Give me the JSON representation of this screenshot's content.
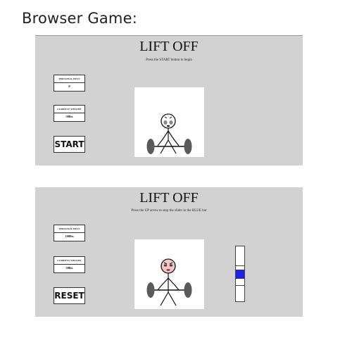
{
  "caption": "Browser Game:",
  "screens": [
    {
      "title": "LIFT OFF",
      "instruction": "Press the START button to begin",
      "personal_best": {
        "label": "PERSONAL BEST",
        "value": "0"
      },
      "current_weight": {
        "label": "CURRENT WEIGHT",
        "value": "50lbs"
      },
      "action_button": "START",
      "face_color": "#ffffff"
    },
    {
      "title": "LIFT OFF",
      "instruction": "Press the UP arrow to stop the slider in the BLUE bar",
      "personal_best": {
        "label": "PERSONAL BEST",
        "value": "100lbs"
      },
      "current_weight": {
        "label": "CURRENT WEIGHT",
        "value": "50lbs"
      },
      "action_button": "RESET",
      "face_color": "#f3c6c6"
    }
  ],
  "colors": {
    "panel_bg": "#d2d2d2",
    "target_bar": "#2020e0"
  }
}
